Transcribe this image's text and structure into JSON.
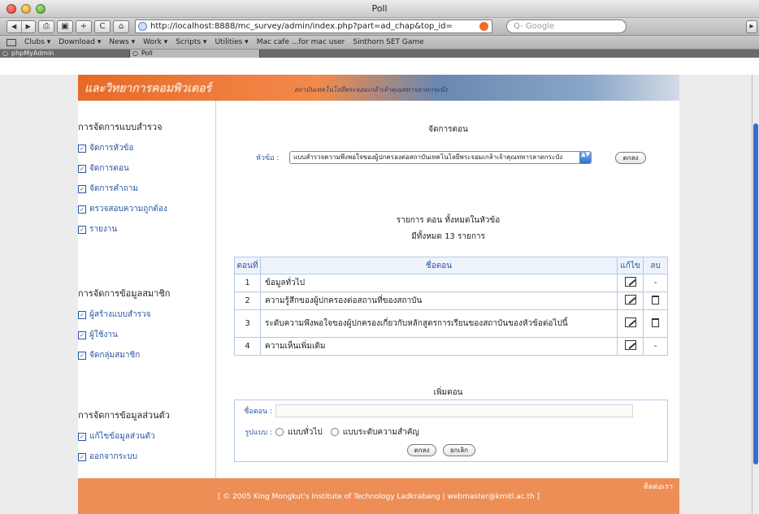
{
  "window": {
    "title": "Poll"
  },
  "toolbar": {
    "nav_back": "◀",
    "nav_forward": "▶",
    "print": "⎙",
    "screen": "▣",
    "add": "+",
    "reload": "C",
    "home": "⌂",
    "url": "http://localhost:8888/mc_survey/admin/index.php?part=ad_chap&top_id=",
    "search_placeholder": "Q- Google",
    "end": "▸"
  },
  "bookmarks": [
    "Clubs ▾",
    "Download ▾",
    "News ▾",
    "Work ▾",
    "Scripts ▾",
    "Utilities ▾",
    "Mac cafe ...for mac user",
    "Sinthorn SET Game"
  ],
  "tabs": [
    {
      "label": "phpMyAdmin",
      "active": false
    },
    {
      "label": "Poll",
      "active": true
    }
  ],
  "banner": {
    "text": "และวิทยาการคอมพิวเตอร์",
    "text2": "สถาบันเทคโนโลยีพระจอมเกล้าเจ้าคุณทหารลาดกระบัง"
  },
  "sidebar": {
    "survey_head": "การจัดการแบบสำรวจ",
    "survey_links": [
      "จัดการหัวข้อ",
      "จัดการตอน",
      "จัดการคำถาม",
      "ตรวจสอบความถูกต้อง",
      "รายงาน"
    ],
    "member_head": "การจัดการข้อมูลสมาชิก",
    "member_links": [
      "ผู้สร้างแบบสำรวจ",
      "ผู้ใช้งาน",
      "จัดกลุ่มสมาชิก"
    ],
    "personal_head": "การจัดการข้อมูลส่วนตัว",
    "personal_links": [
      "แก้ไขข้อมูลส่วนตัว",
      "ออกจากระบบ"
    ],
    "check_mark": "✓"
  },
  "main": {
    "heading": "จัดการตอน",
    "topic_label": "หัวข้อ :",
    "topic_value": "แบบสำรวจความพึงพอใจของผู้ปกครองต่อสถาบันเทคโนโลยีพระจอมเกล้าเจ้าคุณทหารลาดกระบัง",
    "topic_arrow": "▲▼",
    "ok_button": "ตกลง",
    "list_title": "รายการ ตอน ทั้งหมดในหัวข้อ",
    "count_text": "มีทั้งหมด 13 รายการ",
    "table": {
      "headers": [
        "ตอนที่",
        "ชื่อตอน",
        "แก้ไข",
        "ลบ"
      ],
      "rows": [
        {
          "no": "1",
          "name": "ข้อมูลทั่วไป",
          "delete": "-"
        },
        {
          "no": "2",
          "name": "ความรู้สึกของผู้ปกครองต่อสถานที่ของสถาบัน",
          "delete": "trash"
        },
        {
          "no": "3",
          "name": "ระดับความพึงพอใจของผู้ปกครองเกี่ยวกับหลักสูตรการเรียนของสถาบันของหัวข้อต่อไปนี้",
          "delete": "trash"
        },
        {
          "no": "4",
          "name": "ความเห็นเพิ่มเติม",
          "delete": "-"
        }
      ]
    },
    "add_title": "เพิ่มตอน",
    "add_name_label": "ชื่อตอน :",
    "add_format_label": "รูปแบบ :",
    "format_options": [
      "แบบทั่วไป",
      "แบบระดับความสำคัญ"
    ],
    "submit_label": "ตกลง",
    "cancel_label": "ยกเลิก"
  },
  "footer": {
    "contact": "ติดต่อเรา",
    "copyright": "[ © 2005 King Mongkut's Institute of Technology Ladkrabang | webmaster@kmitl.ac.th ]"
  }
}
